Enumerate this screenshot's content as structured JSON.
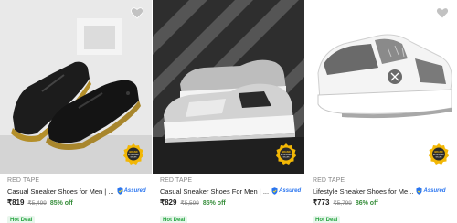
{
  "products": [
    {
      "brand": "RED TAPE",
      "title": "Casual Sneaker Shoes for Men | ...",
      "assured_label": "Assured",
      "price": "₹819",
      "mrp": "₹5,499",
      "discount": "85% off",
      "deal": "Hot Deal",
      "badge_lines": [
        "BRAND",
        "AUTHORISED",
        "SELLER"
      ],
      "image_icon": "black-leather-sneakers-image"
    },
    {
      "brand": "RED TAPE",
      "title": "Casual Sneaker Shoes For Men | ...",
      "assured_label": "Assured",
      "price": "₹829",
      "mrp": "₹5,599",
      "discount": "85% off",
      "deal": "Hot Deal",
      "badge_lines": [
        "BRAND",
        "AUTHORISED",
        "SELLER"
      ],
      "image_icon": "grey-white-sneaker-image"
    },
    {
      "brand": "RED TAPE",
      "title": "Lifestyle Sneaker Shoes for Me...",
      "assured_label": "Assured",
      "price": "₹773",
      "mrp": "₹5,799",
      "discount": "86% off",
      "deal": "Hot Deal",
      "badge_lines": [
        "BRAND",
        "AUTHORISED",
        "SELLER"
      ],
      "image_icon": "white-grey-sneaker-image"
    }
  ],
  "colors": {
    "price_text": "#212121",
    "discount_green": "#388e3c",
    "deal_green": "#26a541",
    "assured_blue": "#2874f0",
    "badge_gold": "#f2b705"
  }
}
